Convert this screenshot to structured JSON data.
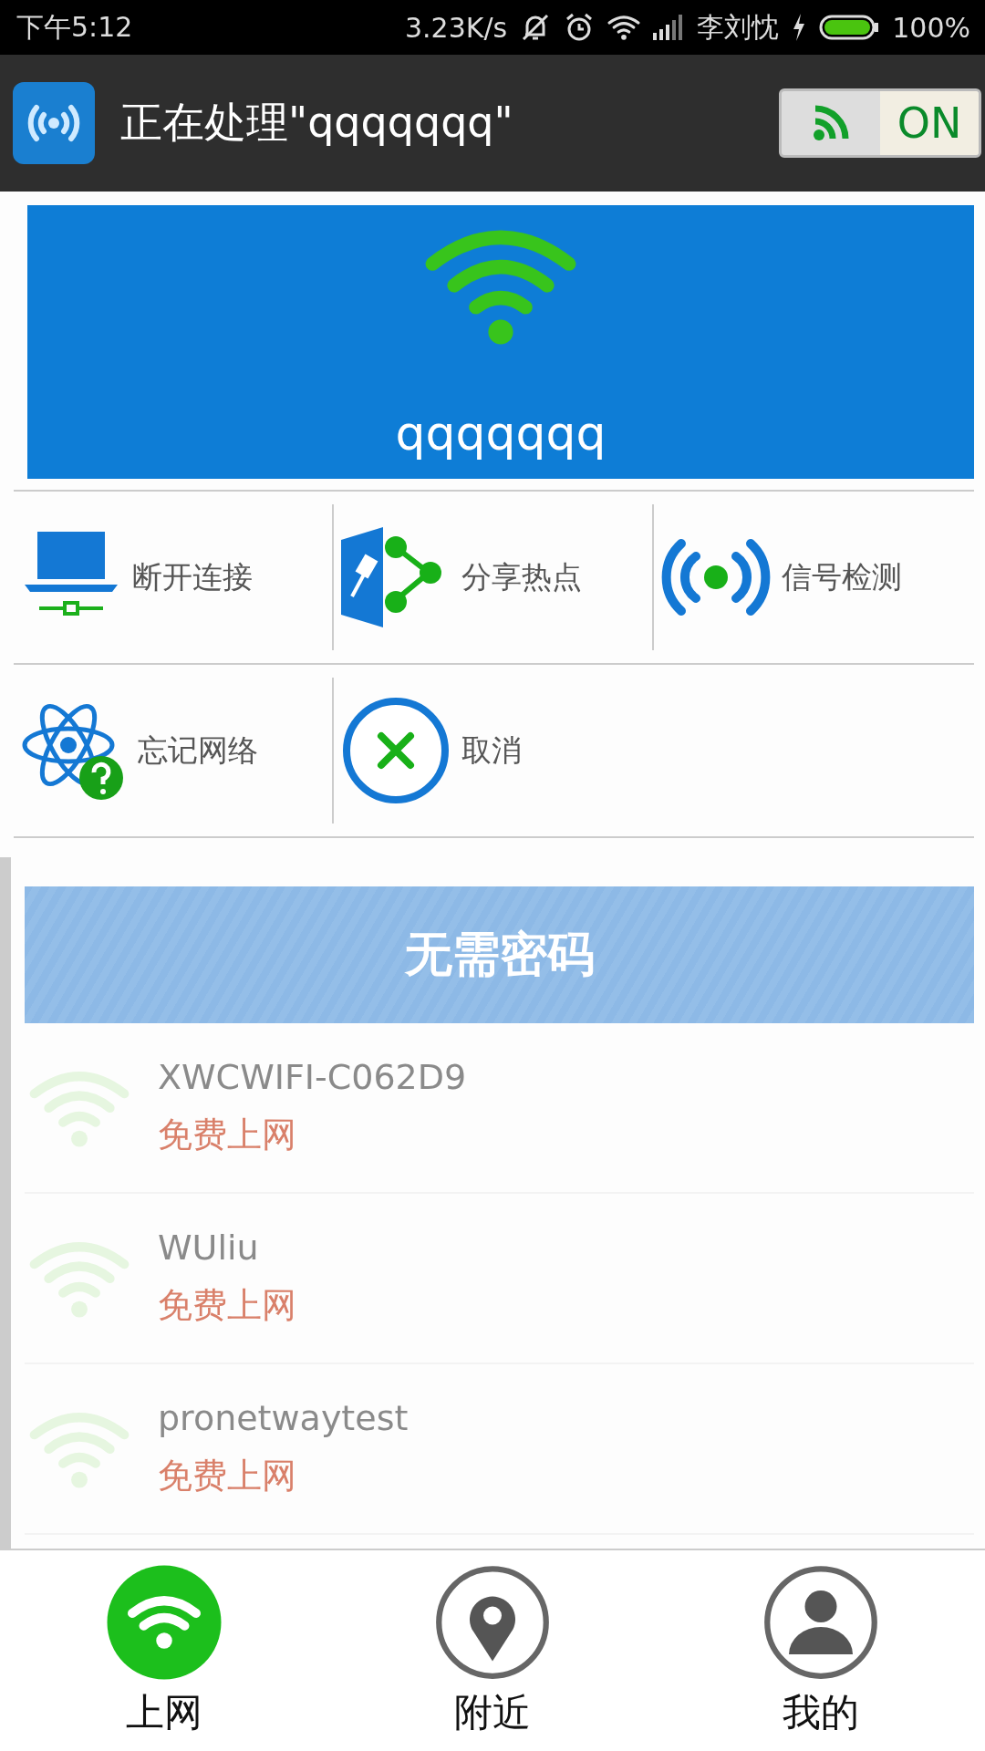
{
  "status_bar": {
    "time": "下午5:12",
    "speed": "3.23K/s",
    "carrier": "李刘忱",
    "battery": "100%"
  },
  "app_bar": {
    "title": "正在处理\"qqqqqqq\"",
    "toggle": {
      "label": "ON",
      "on": true
    }
  },
  "dialog": {
    "network_name": "qqqqqqq",
    "actions": [
      {
        "label": "断开连接",
        "kind": "disconnect"
      },
      {
        "label": "分享热点",
        "kind": "share"
      },
      {
        "label": "信号检测",
        "kind": "signal"
      },
      {
        "label": "忘记网络",
        "kind": "forget"
      },
      {
        "label": "取消",
        "kind": "cancel"
      }
    ]
  },
  "list": {
    "section_header": "无需密码",
    "networks": [
      {
        "name": "XWCWIFI-C062D9",
        "status": "免费上网"
      },
      {
        "name": "WUliu",
        "status": "免费上网"
      },
      {
        "name": "pronetwaytest",
        "status": "免费上网"
      }
    ]
  },
  "tabs": [
    {
      "label": "上网",
      "kind": "wifi",
      "selected": true
    },
    {
      "label": "附近",
      "kind": "pin",
      "selected": false
    },
    {
      "label": "我的",
      "kind": "person",
      "selected": false
    }
  ]
}
